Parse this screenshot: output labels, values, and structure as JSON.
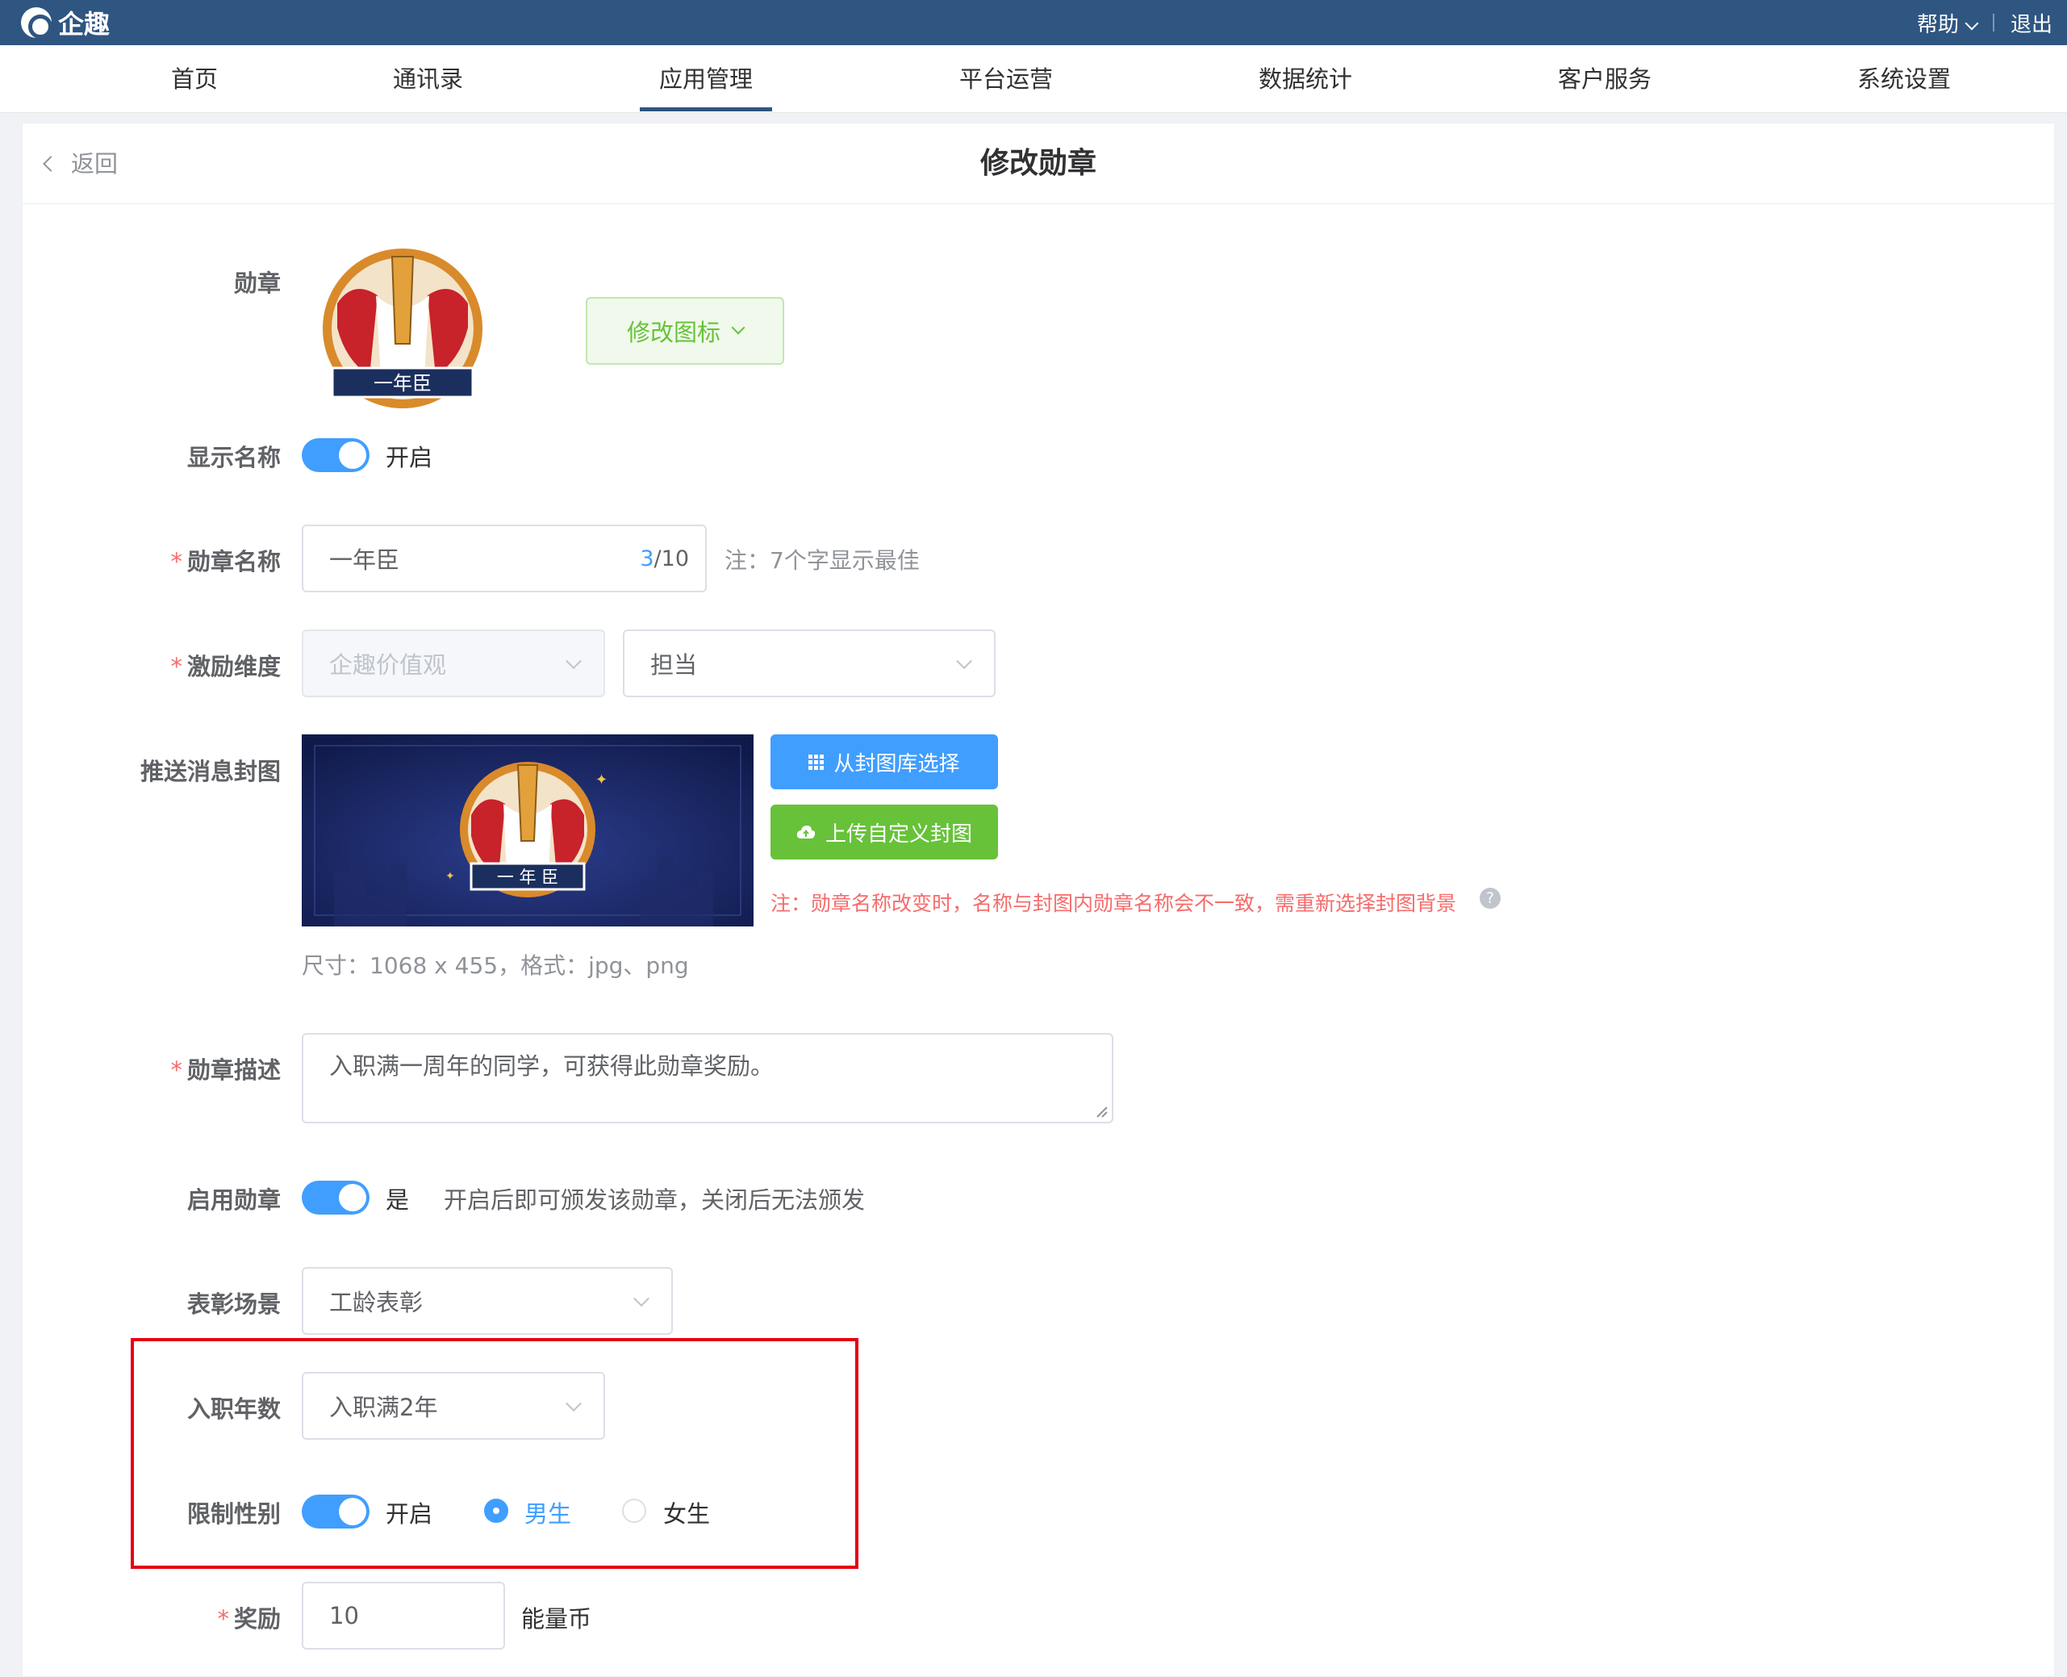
{
  "header": {
    "logo_text": "企趣",
    "help_label": "帮助",
    "logout_label": "退出"
  },
  "nav": {
    "items": [
      "首页",
      "通讯录",
      "应用管理",
      "平台运营",
      "数据统计",
      "客户服务",
      "系统设置"
    ],
    "active_index": 2
  },
  "page": {
    "back_label": "返回",
    "title": "修改勋章"
  },
  "form": {
    "badge": {
      "label": "勋章",
      "badge_text": "一年臣",
      "change_icon_label": "修改图标"
    },
    "show_name": {
      "label": "显示名称",
      "state_text": "开启",
      "on": true
    },
    "badge_name": {
      "label": "勋章名称",
      "value": "一年臣",
      "count": "3",
      "max": "/10",
      "note": "注：7个字显示最佳"
    },
    "dimension": {
      "label": "激励维度",
      "first_value": "企趣价值观",
      "second_value": "担当"
    },
    "cover": {
      "label": "推送消息封图",
      "cover_badge_text": "一 年 臣",
      "gallery_button": "从封图库选择",
      "upload_button": "上传自定义封图",
      "warning": "注：勋章名称改变时，名称与封图内勋章名称会不一致，需重新选择封图背景",
      "size_hint": "尺寸：1068 x 455，格式：jpg、png"
    },
    "description": {
      "label": "勋章描述",
      "value": "入职满一周年的同学，可获得此勋章奖励。"
    },
    "enable": {
      "label": "启用勋章",
      "state_text": "是",
      "hint": "开启后即可颁发该勋章，关闭后无法颁发",
      "on": true
    },
    "scene": {
      "label": "表彰场景",
      "value": "工龄表彰"
    },
    "years": {
      "label": "入职年数",
      "value": "入职满2年"
    },
    "gender": {
      "label": "限制性别",
      "state_text": "开启",
      "on": true,
      "options": [
        "男生",
        "女生"
      ],
      "selected": "男生"
    },
    "reward": {
      "label": "奖励",
      "value": "10",
      "unit": "能量币"
    }
  },
  "colors": {
    "header_bg": "#2f5581",
    "primary": "#409eff",
    "success": "#67c23a",
    "danger": "#f56c6c",
    "highlight_box": "#e60012"
  }
}
